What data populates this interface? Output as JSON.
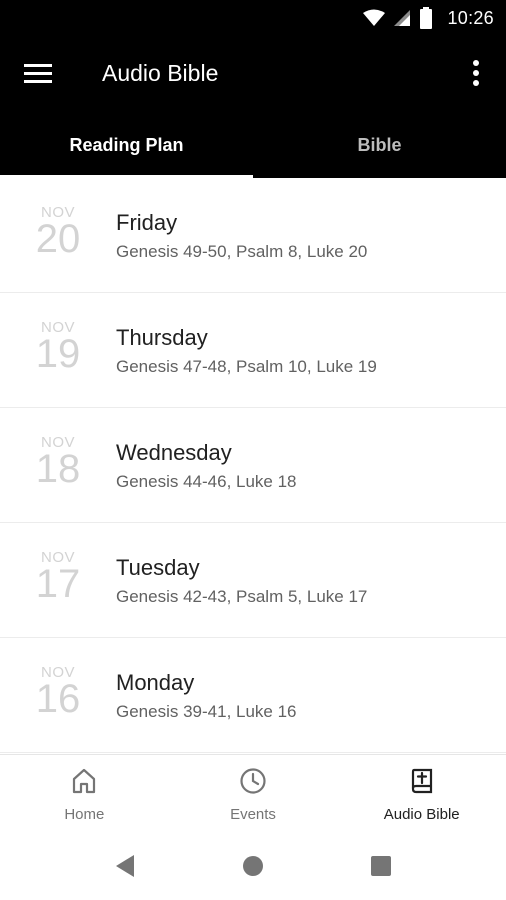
{
  "status_bar": {
    "time": "10:26"
  },
  "app_bar": {
    "title": "Audio Bible"
  },
  "tabs": [
    {
      "label": "Reading Plan",
      "active": true
    },
    {
      "label": "Bible",
      "active": false
    }
  ],
  "readings": [
    {
      "month": "NOV",
      "day": "20",
      "weekday": "Friday",
      "passages": "Genesis 49-50, Psalm 8, Luke 20"
    },
    {
      "month": "NOV",
      "day": "19",
      "weekday": "Thursday",
      "passages": "Genesis 47-48, Psalm 10, Luke 19"
    },
    {
      "month": "NOV",
      "day": "18",
      "weekday": "Wednesday",
      "passages": "Genesis 44-46, Luke 18"
    },
    {
      "month": "NOV",
      "day": "17",
      "weekday": "Tuesday",
      "passages": "Genesis 42-43, Psalm 5, Luke 17"
    },
    {
      "month": "NOV",
      "day": "16",
      "weekday": "Monday",
      "passages": "Genesis 39-41, Luke 16"
    }
  ],
  "bottom_nav": [
    {
      "label": "Home",
      "icon": "home-icon",
      "active": false
    },
    {
      "label": "Events",
      "icon": "clock-icon",
      "active": false
    },
    {
      "label": "Audio Bible",
      "icon": "bible-icon",
      "active": true
    }
  ],
  "colors": {
    "app_bar_bg": "#000000",
    "tab_active": "#ffffff",
    "tab_inactive": "#bdbdbd",
    "date_text": "#d3d3d3",
    "secondary_text": "#616161"
  }
}
